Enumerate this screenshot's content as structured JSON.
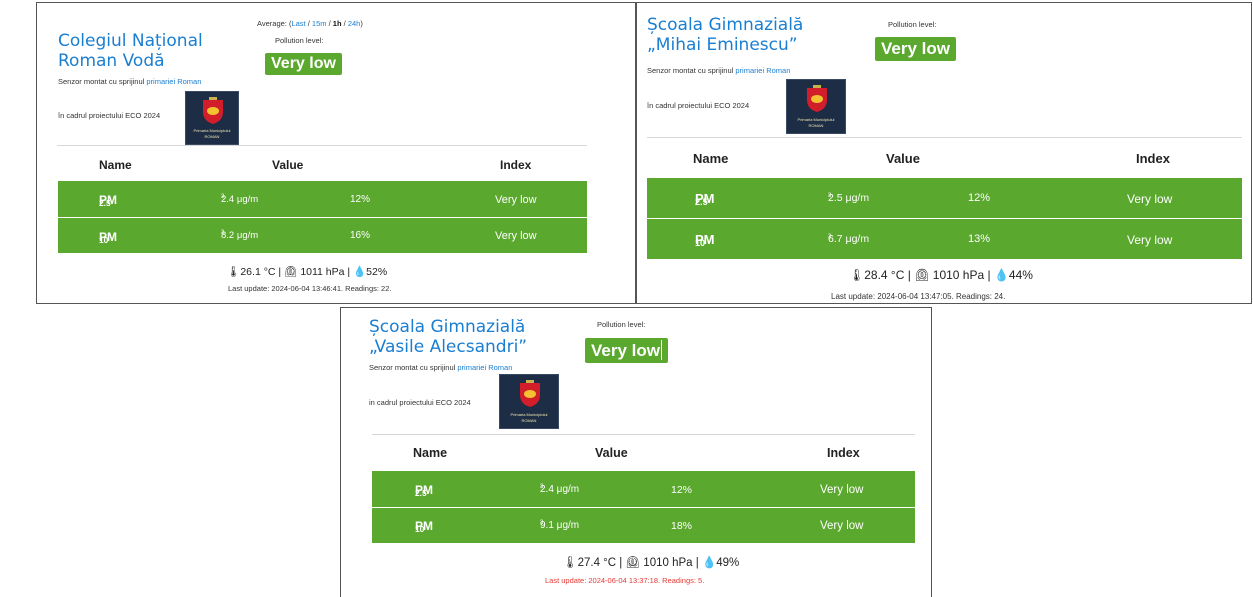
{
  "cards": [
    {
      "title_lines": [
        "Colegiul Național",
        "Roman Vodă"
      ],
      "sponsor_text": "Senzor montat cu sprijinul ",
      "sponsor_link": "primariei Roman",
      "project_text": "în cadrul proiectului ECO 2024",
      "logo_caption": [
        "Primaria Municipiului",
        "ROMAN"
      ],
      "average": {
        "label": "Average: (",
        "last": "Last",
        "sep1": " / ",
        "m15": "15m",
        "sep2": " / ",
        "h1": "1h",
        "sep3": " / ",
        "h24": "24h",
        "end": ")"
      },
      "pollution_label": "Pollution level:",
      "pollution_value": "Very low",
      "headers": {
        "name": "Name",
        "value": "Value",
        "index": "Index"
      },
      "rows": [
        {
          "pm": "PM",
          "sub": "2.5",
          "value": "2.4 μg/m",
          "exp": "3",
          "percent": "12%",
          "index": "Very low"
        },
        {
          "pm": "PM",
          "sub": "10",
          "value": "8.2 μg/m",
          "exp": "3",
          "percent": "16%",
          "index": "Very low"
        }
      ],
      "environment": "26.1 °C | 1011 hPa | 52%",
      "env_parts": {
        "temp": "26.1 °C",
        "pressure": "1011 hPa",
        "humidity": "52%"
      },
      "last_update": "Last update: 2024-06-04 13:46:41. Readings: 22."
    },
    {
      "title_lines": [
        "Școala Gimnazială",
        "„Mihai Eminescu”"
      ],
      "sponsor_text": "Senzor montat cu sprijinul ",
      "sponsor_link": "primariei Roman",
      "project_text": "în cadrul proiectului ECO 2024",
      "logo_caption": [
        "Primaria Municipiului",
        "ROMAN"
      ],
      "pollution_label": "Pollution level:",
      "pollution_value": "Very low",
      "headers": {
        "name": "Name",
        "value": "Value",
        "index": "Index"
      },
      "rows": [
        {
          "pm": "PM",
          "sub": "2.5",
          "value": "2.5 μg/m",
          "exp": "3",
          "percent": "12%",
          "index": "Very low"
        },
        {
          "pm": "PM",
          "sub": "10",
          "value": "6.7 μg/m",
          "exp": "3",
          "percent": "13%",
          "index": "Very low"
        }
      ],
      "env_parts": {
        "temp": "28.4 °C",
        "pressure": "1010 hPa",
        "humidity": "44%"
      },
      "last_update": "Last update: 2024-06-04 13:47:05. Readings: 24."
    },
    {
      "title_lines": [
        "Școala Gimnazială",
        "„Vasile Alecsandri”"
      ],
      "sponsor_text": "Senzor montat cu sprijinul ",
      "sponsor_link": "primariei Roman",
      "project_text": "in cadrul proiectului ECO 2024",
      "logo_caption": [
        "Primaria Municipiului",
        "ROMAN"
      ],
      "pollution_label": "Pollution level:",
      "pollution_value": "Very low",
      "headers": {
        "name": "Name",
        "value": "Value",
        "index": "Index"
      },
      "rows": [
        {
          "pm": "PM",
          "sub": "2.5",
          "value": "2.4 μg/m",
          "exp": "3",
          "percent": "12%",
          "index": "Very low"
        },
        {
          "pm": "PM",
          "sub": "10",
          "value": "9.1 μg/m",
          "exp": "3",
          "percent": "18%",
          "index": "Very low"
        }
      ],
      "env_parts": {
        "temp": "27.4 °C",
        "pressure": "1010 hPa",
        "humidity": "49%"
      },
      "last_update": "Last update: 2024-06-04 13:37:18. Readings: 5.",
      "last_update_color": "#e53935"
    }
  ],
  "colors": {
    "accent": "#1a7ed1",
    "level_green": "#5aa82e",
    "stale_red": "#e53935"
  }
}
